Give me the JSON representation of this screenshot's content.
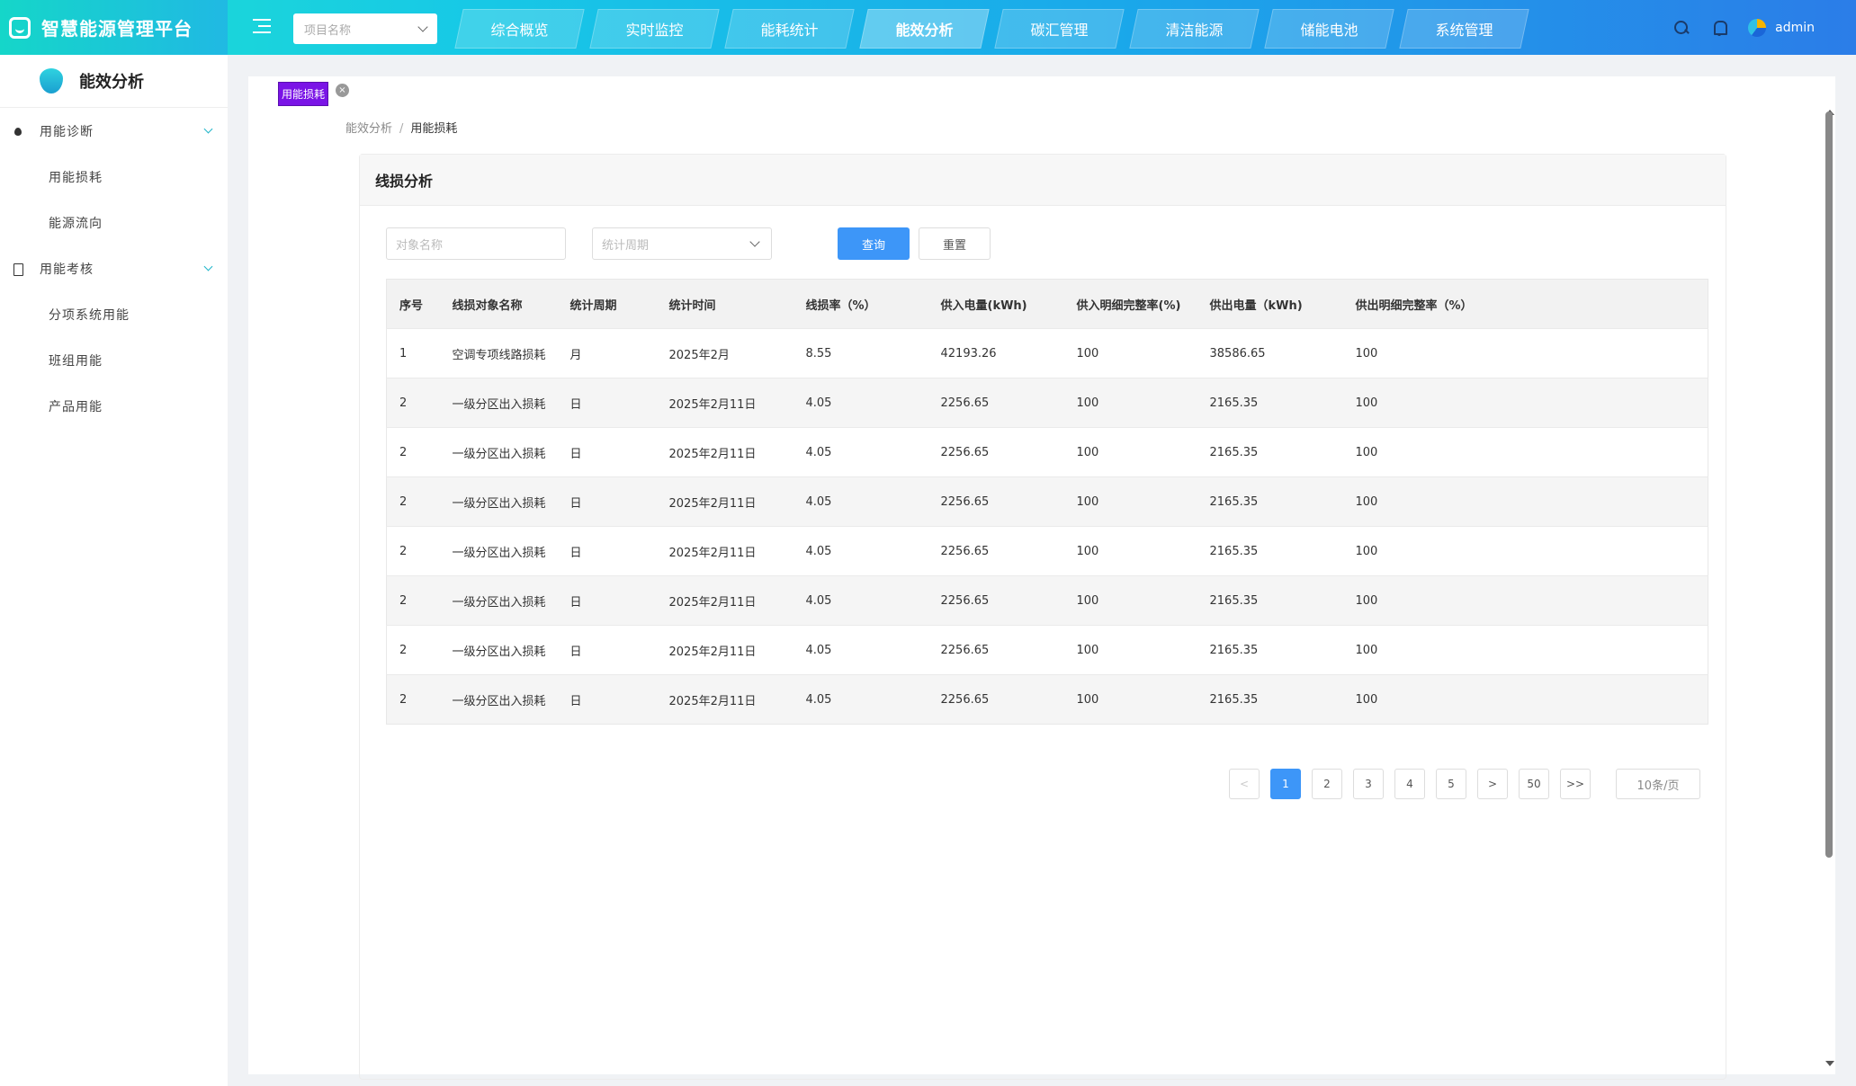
{
  "app": {
    "title": "智慧能源管理平台"
  },
  "header": {
    "project_placeholder": "项目名称",
    "tabs": [
      {
        "label": "综合概览"
      },
      {
        "label": "实时监控"
      },
      {
        "label": "能耗统计"
      },
      {
        "label": "能效分析",
        "active": true
      },
      {
        "label": "碳汇管理"
      },
      {
        "label": "清洁能源"
      },
      {
        "label": "储能电池"
      },
      {
        "label": "系统管理"
      }
    ],
    "user": "admin"
  },
  "sidebar": {
    "title": "能效分析",
    "groups": [
      {
        "label": "用能诊断",
        "icon": "drop-icon",
        "items": [
          {
            "label": "用能损耗"
          },
          {
            "label": "能源流向"
          }
        ]
      },
      {
        "label": "用能考核",
        "icon": "document-icon",
        "items": [
          {
            "label": "分项系统用能"
          },
          {
            "label": "班组用能"
          },
          {
            "label": "产品用能"
          }
        ]
      }
    ]
  },
  "page": {
    "tag": "用能损耗",
    "tag_close": "×",
    "breadcrumb": {
      "parent": "能效分析",
      "sep": "/",
      "current": "用能损耗"
    },
    "card_title": "线损分析",
    "filters": {
      "name_placeholder": "对象名称",
      "period_placeholder": "统计周期",
      "query": "查询",
      "reset": "重置"
    },
    "table": {
      "columns": [
        "序号",
        "线损对象名称",
        "统计周期",
        "统计时间",
        "线损率（%）",
        "供入电量(kWh)",
        "供入明细完整率(%)",
        "供出电量（kWh)",
        "供出明细完整率（%）"
      ],
      "rows": [
        [
          "1",
          "空调专项线路损耗",
          "月",
          "2025年2月",
          "8.55",
          "42193.26",
          "100",
          "38586.65",
          "100"
        ],
        [
          "2",
          "一级分区出入损耗",
          "日",
          "2025年2月11日",
          "4.05",
          "2256.65",
          "100",
          "2165.35",
          "100"
        ],
        [
          "2",
          "一级分区出入损耗",
          "日",
          "2025年2月11日",
          "4.05",
          "2256.65",
          "100",
          "2165.35",
          "100"
        ],
        [
          "2",
          "一级分区出入损耗",
          "日",
          "2025年2月11日",
          "4.05",
          "2256.65",
          "100",
          "2165.35",
          "100"
        ],
        [
          "2",
          "一级分区出入损耗",
          "日",
          "2025年2月11日",
          "4.05",
          "2256.65",
          "100",
          "2165.35",
          "100"
        ],
        [
          "2",
          "一级分区出入损耗",
          "日",
          "2025年2月11日",
          "4.05",
          "2256.65",
          "100",
          "2165.35",
          "100"
        ],
        [
          "2",
          "一级分区出入损耗",
          "日",
          "2025年2月11日",
          "4.05",
          "2256.65",
          "100",
          "2165.35",
          "100"
        ],
        [
          "2",
          "一级分区出入损耗",
          "日",
          "2025年2月11日",
          "4.05",
          "2256.65",
          "100",
          "2165.35",
          "100"
        ]
      ]
    },
    "pagination": {
      "prev": "<",
      "pages": [
        "1",
        "2",
        "3",
        "4",
        "5"
      ],
      "current": "1",
      "next": ">",
      "last_page": "50",
      "last": ">>",
      "page_size": "10条/页"
    }
  },
  "colors": {
    "primary": "#3d96f8",
    "tag": "#7a14e6",
    "header_start": "#1ee0d0",
    "header_end": "#2b7de8"
  }
}
